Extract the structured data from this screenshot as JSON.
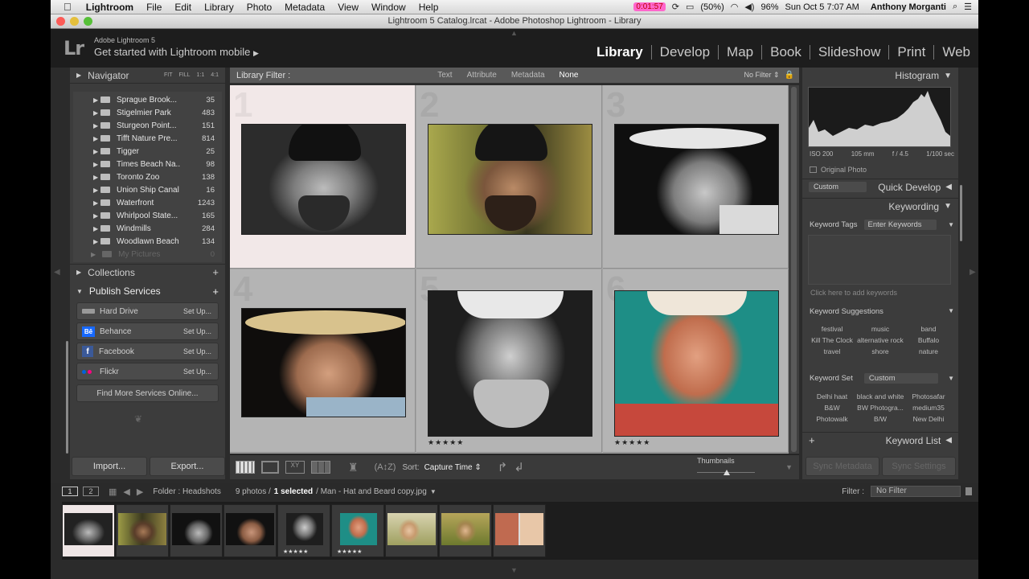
{
  "menubar": {
    "app": "Lightroom",
    "items": [
      "File",
      "Edit",
      "Library",
      "Photo",
      "Metadata",
      "View",
      "Window",
      "Help"
    ],
    "timer": "0:01:57",
    "battery_pct": "(50%)",
    "battery2": "96%",
    "clock": "Sun Oct 5  7:07 AM",
    "user": "Anthony Morganti"
  },
  "titlebar": {
    "title": "Lightroom 5 Catalog.lrcat - Adobe Photoshop Lightroom - Library"
  },
  "identity": {
    "product": "Adobe Lightroom 5",
    "mobile": "Get started with Lightroom mobile",
    "modules": [
      "Library",
      "Develop",
      "Map",
      "Book",
      "Slideshow",
      "Print",
      "Web"
    ],
    "active_module": "Library"
  },
  "navigator": {
    "label": "Navigator",
    "zooms": [
      "FIT",
      "FILL",
      "1:1",
      "4:1"
    ]
  },
  "folders": [
    {
      "name": "Sprague Brook...",
      "count": "35"
    },
    {
      "name": "Stigelmier Park",
      "count": "483"
    },
    {
      "name": "Sturgeon Point...",
      "count": "151"
    },
    {
      "name": "Tifft Nature Pre...",
      "count": "814"
    },
    {
      "name": "Tigger",
      "count": "25"
    },
    {
      "name": "Times Beach Na...",
      "count": "98"
    },
    {
      "name": "Toronto Zoo",
      "count": "138"
    },
    {
      "name": "Union Ship Canal",
      "count": "16"
    },
    {
      "name": "Waterfront",
      "count": "1243"
    },
    {
      "name": "Whirlpool State...",
      "count": "165"
    },
    {
      "name": "Windmills",
      "count": "284"
    },
    {
      "name": "Woodlawn Beach",
      "count": "134"
    }
  ],
  "my_pictures": {
    "name": "My Pictures",
    "count": "0"
  },
  "collections": {
    "label": "Collections"
  },
  "publish": {
    "label": "Publish Services",
    "services": [
      {
        "name": "Hard Drive",
        "action": "Set Up..."
      },
      {
        "name": "Behance",
        "action": "Set Up..."
      },
      {
        "name": "Facebook",
        "action": "Set Up..."
      },
      {
        "name": "Flickr",
        "action": "Set Up..."
      }
    ],
    "find_more": "Find More Services Online..."
  },
  "left_buttons": {
    "import": "Import...",
    "export": "Export..."
  },
  "filter": {
    "label": "Library Filter :",
    "tabs": [
      "Text",
      "Attribute",
      "Metadata",
      "None"
    ],
    "active": "None",
    "preset": "No Filter"
  },
  "grid": {
    "cells": [
      {
        "index": "1",
        "stars": ""
      },
      {
        "index": "2",
        "stars": ""
      },
      {
        "index": "3",
        "stars": ""
      },
      {
        "index": "4",
        "stars": ""
      },
      {
        "index": "5",
        "stars": "★★★★★"
      },
      {
        "index": "6",
        "stars": "★★★★★"
      }
    ]
  },
  "toolbar": {
    "sort_label": "Sort:",
    "sort_value": "Capture Time",
    "thumbnails_label": "Thumbnails"
  },
  "histogram": {
    "label": "Histogram",
    "iso": "ISO 200",
    "focal": "105 mm",
    "aperture": "f / 4.5",
    "shutter": "1/100 sec",
    "original_photo": "Original Photo"
  },
  "quick_develop": {
    "label": "Quick Develop",
    "preset": "Custom"
  },
  "keywording": {
    "label": "Keywording",
    "keyword_tags_label": "Keyword Tags",
    "keyword_tags_value": "Enter Keywords",
    "placeholder": "Click here to add keywords",
    "suggestions_label": "Keyword Suggestions",
    "suggestions": [
      "festival",
      "music",
      "band",
      "Kill The Clock",
      "alternative rock",
      "Buffalo",
      "travel",
      "shore",
      "nature"
    ],
    "set_label": "Keyword Set",
    "set_value": "Custom",
    "set_keywords": [
      "Delhi haat",
      "black and white",
      "Photosafar",
      "B&W",
      "BW Photogra...",
      "medium35",
      "Photowalk",
      "B/W",
      "New Delhi"
    ]
  },
  "keyword_list": {
    "label": "Keyword List"
  },
  "sync": {
    "metadata": "Sync Metadata",
    "settings": "Sync Settings"
  },
  "filmbar": {
    "page1": "1",
    "page2": "2",
    "source": "Folder : Headshots",
    "count_prefix": "9 photos /",
    "selected": "1 selected",
    "filename": "/ Man - Hat and Beard copy.jpg",
    "filter_label": "Filter :",
    "filter_value": "No Filter"
  },
  "filmstrip": {
    "stars": [
      "",
      "",
      "",
      "",
      "★★★★★",
      "★★★★★",
      "",
      "",
      ""
    ]
  }
}
